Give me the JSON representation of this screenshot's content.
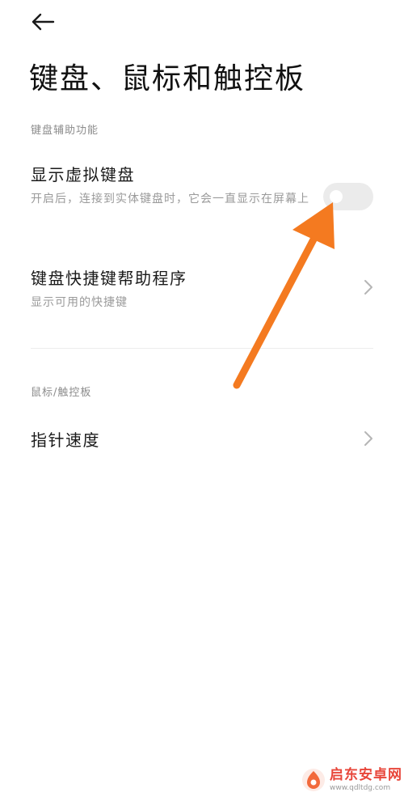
{
  "header": {
    "back_icon": "arrow-left-icon",
    "title": "键盘、鼠标和触控板"
  },
  "sections": [
    {
      "header": "键盘辅助功能",
      "items": [
        {
          "title": "显示虚拟键盘",
          "subtitle": "开启后，连接到实体键盘时，它会一直显示在屏幕上",
          "control": "toggle",
          "toggle_on": false
        },
        {
          "title": "键盘快捷键帮助程序",
          "subtitle": "显示可用的快捷键",
          "control": "chevron-right-icon"
        }
      ]
    },
    {
      "header": "鼠标/触控板",
      "items": [
        {
          "title": "指针速度",
          "control": "chevron-right-icon"
        }
      ]
    }
  ],
  "annotation": {
    "icon": "arrow-up-right-icon",
    "color": "#f47a20"
  },
  "colors": {
    "background": "#ffffff",
    "toggle_off_track": "#ebebeb",
    "secondary_text": "#9a9a9a"
  },
  "watermark": {
    "name": "启东安卓网",
    "url": "www.qdltdg.com"
  }
}
